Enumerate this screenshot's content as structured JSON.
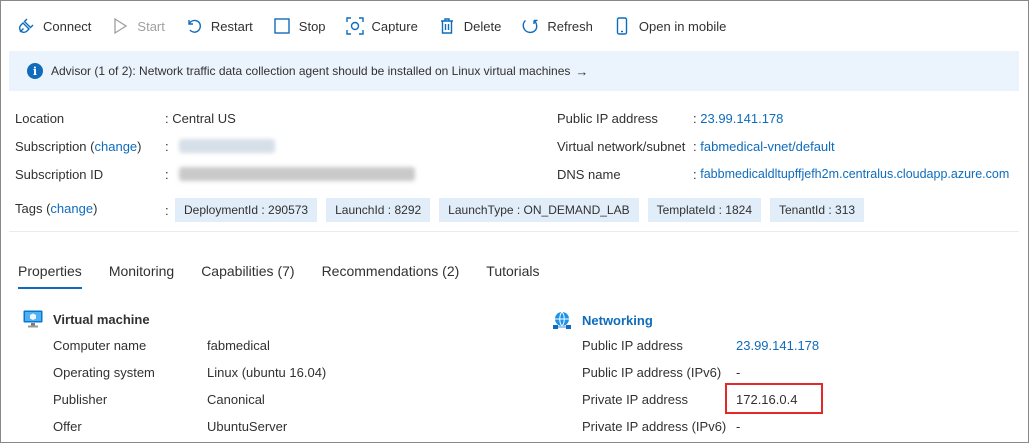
{
  "toolbar": {
    "connect": "Connect",
    "start": "Start",
    "restart": "Restart",
    "stop": "Stop",
    "capture": "Capture",
    "delete": "Delete",
    "refresh": "Refresh",
    "open_mobile": "Open in mobile"
  },
  "advisor": {
    "text": "Advisor (1 of 2): Network traffic data collection agent should be installed on Linux virtual machines",
    "arrow": "→"
  },
  "essentials": {
    "sep": ":",
    "location_label": "Location",
    "location_value": "Central US",
    "subscription_label": "Subscription",
    "subscription_change": "change",
    "subscription_id_label": "Subscription ID",
    "public_ip_label": "Public IP address",
    "public_ip_value": "23.99.141.178",
    "vnet_label": "Virtual network/subnet",
    "vnet_value": "fabmedical-vnet/default",
    "dns_label": "DNS name",
    "dns_value": "fabbmedicaldltupffjefh2m.centralus.cloudapp.azure.com",
    "tags_label": "Tags",
    "tags_change": "change",
    "tags": [
      "DeploymentId : 290573",
      "LaunchId : 8292",
      "LaunchType : ON_DEMAND_LAB",
      "TemplateId : 1824",
      "TenantId : 313"
    ]
  },
  "tabs": [
    {
      "label": "Properties",
      "active": true
    },
    {
      "label": "Monitoring"
    },
    {
      "label": "Capabilities (7)"
    },
    {
      "label": "Recommendations (2)"
    },
    {
      "label": "Tutorials"
    }
  ],
  "vm": {
    "title": "Virtual machine",
    "rows": [
      {
        "label": "Computer name",
        "value": "fabmedical"
      },
      {
        "label": "Operating system",
        "value": "Linux (ubuntu 16.04)"
      },
      {
        "label": "Publisher",
        "value": "Canonical"
      },
      {
        "label": "Offer",
        "value": "UbuntuServer"
      }
    ]
  },
  "networking": {
    "title": "Networking",
    "rows": [
      {
        "label": "Public IP address",
        "value": "23.99.141.178"
      },
      {
        "label": "Public IP address (IPv6)",
        "value": "-"
      },
      {
        "label": "Private IP address",
        "value": "172.16.0.4"
      },
      {
        "label": "Private IP address (IPv6)",
        "value": "-"
      }
    ]
  },
  "colors": {
    "accent": "#0f6cbd",
    "highlight": "#e52929",
    "banner": "#ebf3fc",
    "tag": "#e1eefa"
  }
}
